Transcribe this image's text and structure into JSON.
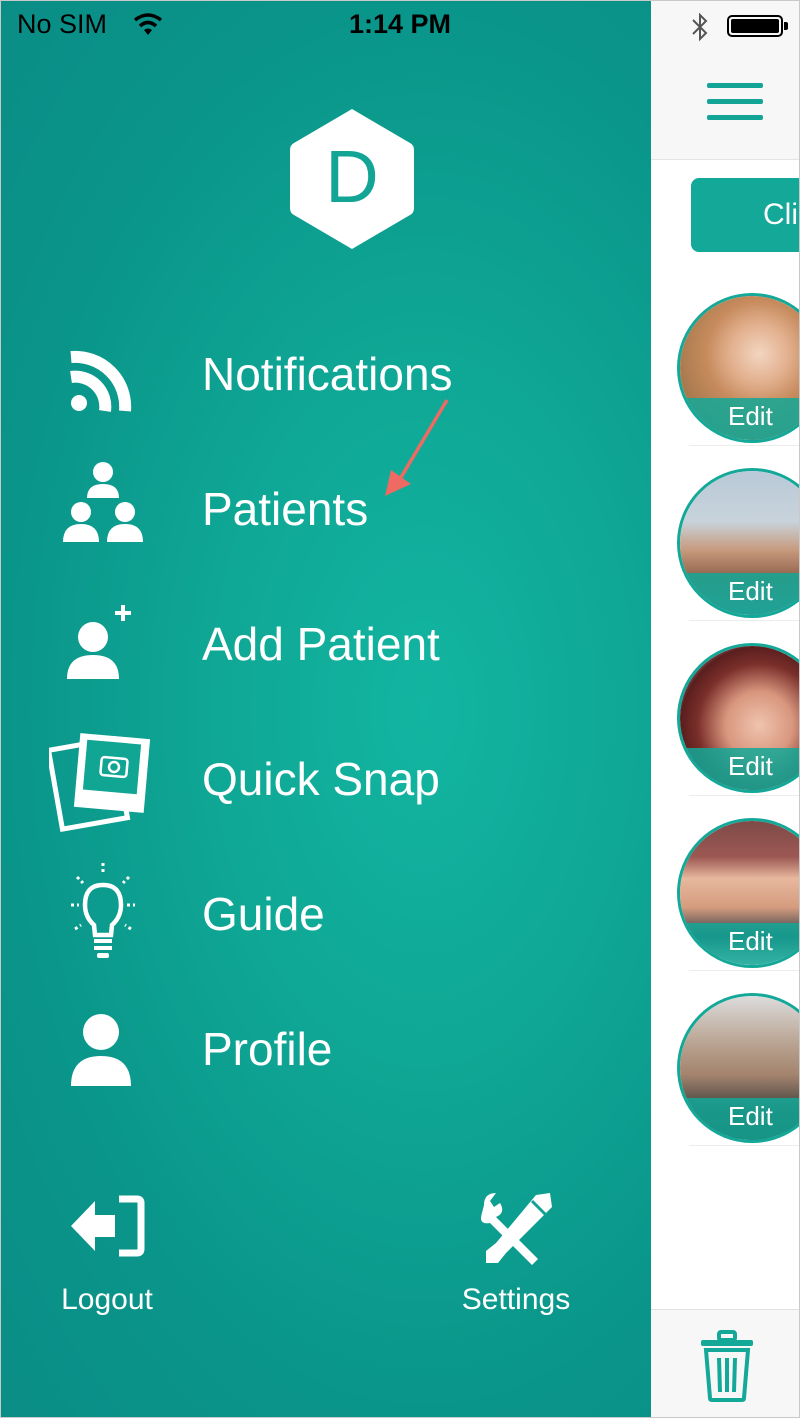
{
  "status_bar": {
    "carrier": "No SIM",
    "time": "1:14 PM"
  },
  "logo": {
    "letter": "D"
  },
  "menu": [
    {
      "label": "Notifications",
      "icon": "rss-icon"
    },
    {
      "label": "Patients",
      "icon": "patients-group-icon"
    },
    {
      "label": "Add Patient",
      "icon": "add-patient-icon"
    },
    {
      "label": "Quick Snap",
      "icon": "camera-photos-icon"
    },
    {
      "label": "Guide",
      "icon": "lightbulb-icon"
    },
    {
      "label": "Profile",
      "icon": "user-icon"
    }
  ],
  "bottom": {
    "logout": "Logout",
    "settings": "Settings"
  },
  "right_pane": {
    "button_partial": "Cli",
    "patients": [
      {
        "edit_label": "Edit"
      },
      {
        "edit_label": "Edit"
      },
      {
        "edit_label": "Edit"
      },
      {
        "edit_label": "Edit"
      },
      {
        "edit_label": "Edit"
      }
    ]
  },
  "colors": {
    "accent": "#12a596",
    "drawer_center": "#12b5a1",
    "drawer_edge": "#0a8d86",
    "annotation_arrow": "#ee6a63"
  }
}
